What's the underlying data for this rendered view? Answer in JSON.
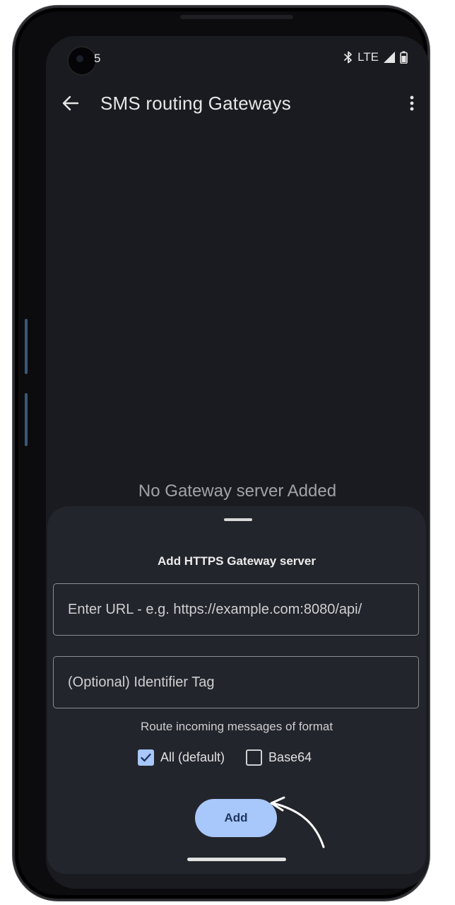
{
  "status_bar": {
    "time": "5",
    "network": "LTE",
    "icons": [
      "bluetooth-icon",
      "signal-icon",
      "battery-icon"
    ]
  },
  "app_bar": {
    "title": "SMS routing Gateways",
    "back_icon": "arrow-left-icon",
    "menu_icon": "more-vertical-icon"
  },
  "empty_state": {
    "message": "No Gateway server Added"
  },
  "sheet": {
    "title": "Add HTTPS Gateway server",
    "url_field": {
      "value": "",
      "placeholder": "Enter URL - e.g. https://example.com:8080/api/"
    },
    "tag_field": {
      "value": "",
      "placeholder": "(Optional) Identifier Tag"
    },
    "route_label": "Route incoming messages of format",
    "options": [
      {
        "label": "All (default)",
        "checked": true
      },
      {
        "label": "Base64",
        "checked": false
      }
    ],
    "add_button": "Add"
  },
  "colors": {
    "background": "#1a1b20",
    "sheet": "#23252c",
    "accent": "#a8c7fa",
    "accent_text": "#1f3760",
    "frame": "#0c0c0e"
  }
}
